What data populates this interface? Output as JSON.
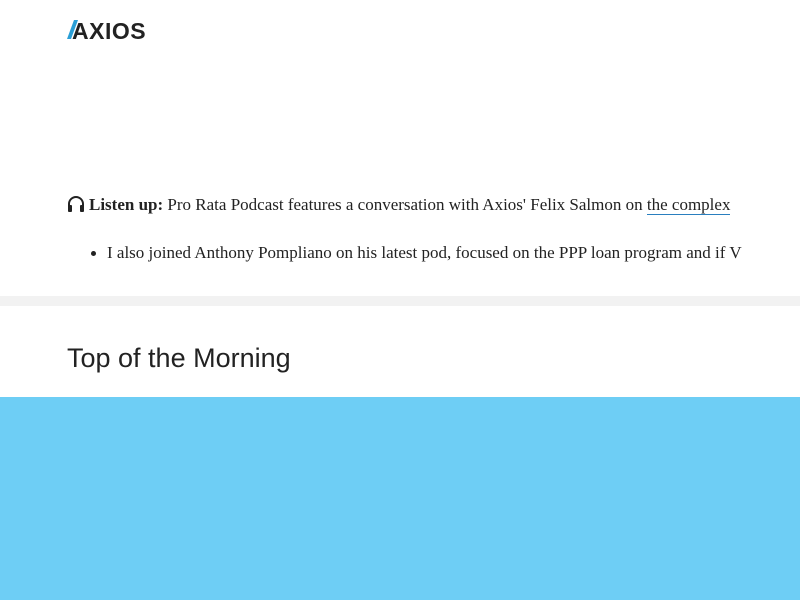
{
  "brand": {
    "logo_text": "AXIOS",
    "logo_accent_color": "#2a9fd6",
    "logo_text_color": "#222222"
  },
  "listen": {
    "icon": "headphones-icon",
    "label": "Listen up:",
    "text": " Pro Rata Podcast features a conversation with Axios' Felix Salmon on ",
    "link_text": "the complex"
  },
  "bullet": {
    "text": "I also joined Anthony Pompliano on his latest pod, focused on the PPP loan program and if V"
  },
  "section": {
    "title": "Top of the Morning"
  },
  "image": {
    "background_color": "#6ecef5"
  },
  "colors": {
    "link_underline": "#2a7fbf",
    "divider": "#f2f2f2"
  }
}
